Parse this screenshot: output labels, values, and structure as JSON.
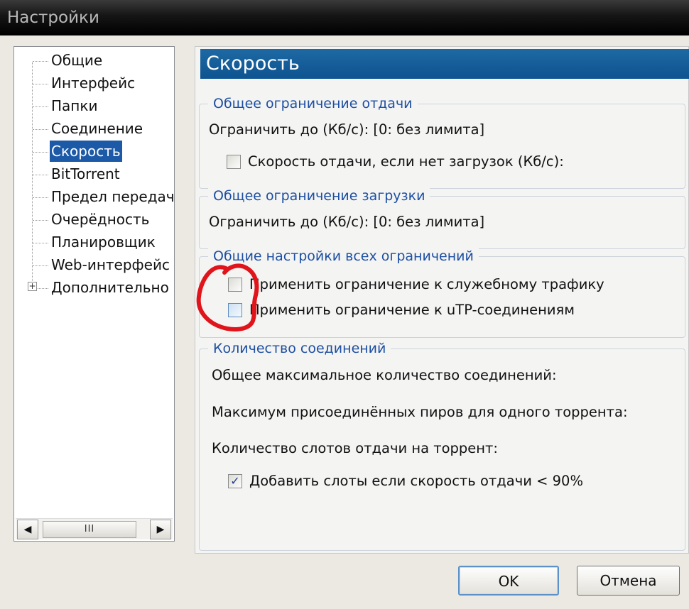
{
  "window": {
    "title": "Настройки"
  },
  "tree": {
    "items": [
      {
        "label": "Общие"
      },
      {
        "label": "Интерфейс"
      },
      {
        "label": "Папки"
      },
      {
        "label": "Соединение"
      },
      {
        "label": "Скорость",
        "selected": true
      },
      {
        "label": "BitTorrent"
      },
      {
        "label": "Предел передачи"
      },
      {
        "label": "Очерёдность"
      },
      {
        "label": "Планировщик"
      },
      {
        "label": "Web-интерфейс"
      },
      {
        "label": "Дополнительно",
        "expander": "+"
      }
    ],
    "scrollbar": {
      "left_arrow": "◀",
      "right_arrow": "▶",
      "thumb_grip": "III"
    }
  },
  "page": {
    "heading": "Скорость",
    "upload_group": {
      "legend": "Общее ограничение отдачи",
      "limit_label": "Ограничить до (Кб/с): [0: без лимита]",
      "no_download_checkbox": {
        "label": "Скорость отдачи, если нет загрузок (Кб/с):",
        "checked": false
      }
    },
    "download_group": {
      "legend": "Общее ограничение загрузки",
      "limit_label": "Ограничить до (Кб/с): [0: без лимита]"
    },
    "global_group": {
      "legend": "Общие настройки всех ограничений",
      "overhead_checkbox": {
        "label": "Применить ограничение к служебному трафику",
        "checked": false
      },
      "utp_checkbox": {
        "label": "Применить ограничение к uTP-соединениям",
        "checked": false
      }
    },
    "connections_group": {
      "legend": "Количество соединений",
      "max_connections_label": "Общее максимальное количество соединений:",
      "max_peers_label": "Максимум присоединённых пиров для одного торрента:",
      "upload_slots_label": "Количество слотов отдачи на торрент:",
      "add_slots_checkbox": {
        "label": "Добавить слоты если скорость отдачи < 90%",
        "checked": true,
        "check_glyph": "✓"
      }
    }
  },
  "buttons": {
    "ok": "OK",
    "cancel": "Отмена"
  },
  "colors": {
    "selection": "#1c5aa8",
    "heading_bg": "#1265a0",
    "legend_text": "#1d4fa2",
    "annotation": "#e0141a"
  }
}
